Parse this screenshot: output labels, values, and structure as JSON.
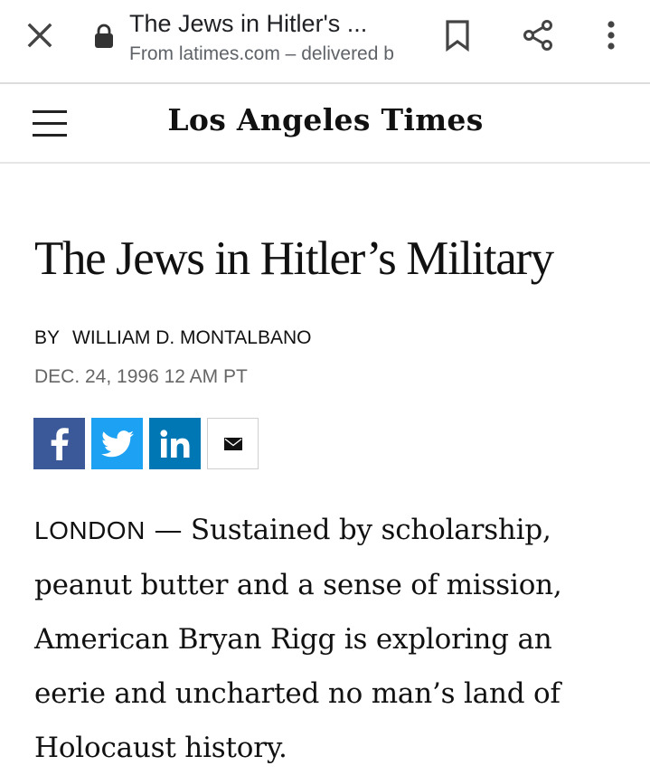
{
  "tab": {
    "title": "The Jews in Hitler's ...",
    "origin": "From latimes.com – delivered b"
  },
  "icons": {
    "close": "close-icon",
    "lock": "lock-icon",
    "bookmark": "bookmark-icon",
    "share": "share-icon",
    "menu": "more-vert-icon",
    "hamburger": "hamburger-menu-icon",
    "facebook": "facebook-icon",
    "twitter": "twitter-icon",
    "linkedin": "linkedin-icon",
    "email": "email-icon"
  },
  "site": {
    "logo": "Los Angeles Times"
  },
  "article": {
    "headline": "The Jews in Hitler’s Military",
    "byline_prefix": "BY",
    "author": "WILLIAM D. MONTALBANO",
    "date": "DEC. 24, 1996 12 AM PT",
    "dateline": "LONDON",
    "dash": " — ",
    "lede": "Sustained by scholarship, peanut butter and a sense of mission, American Bryan Rigg is exploring an eerie and uncharted no man’s land of Holocaust history."
  },
  "colors": {
    "facebook": "#3b5998",
    "twitter": "#1da1f2",
    "linkedin": "#0077b5",
    "date_gray": "#666666"
  }
}
